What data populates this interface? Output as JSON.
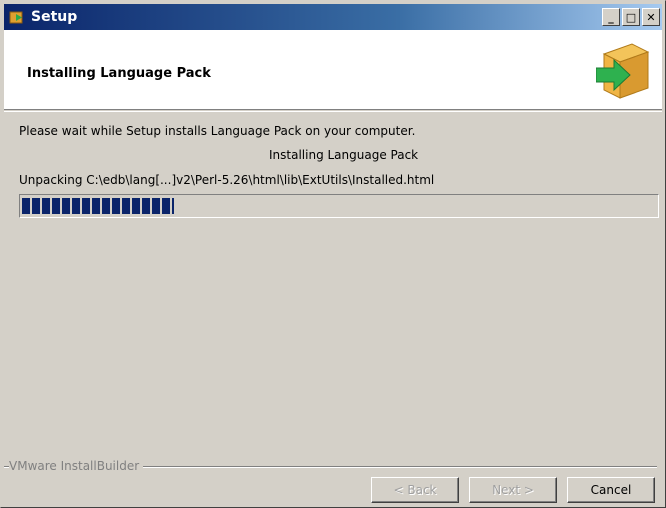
{
  "window": {
    "title": "Setup",
    "controls": {
      "minimize": "_",
      "maximize": "□",
      "close": "✕"
    }
  },
  "header": {
    "title": "Installing Language Pack",
    "icon": "install-box-arrow-icon"
  },
  "body": {
    "message": "Please wait while Setup installs Language Pack on your computer.",
    "status": "Installing Language Pack",
    "detail": "Unpacking C:\\edb\\lang[...]v2\\Perl-5.26\\html\\lib\\ExtUtils\\Installed.html",
    "progress_percent": 24
  },
  "footer": {
    "brand": "VMware InstallBuilder",
    "buttons": {
      "back": "< Back",
      "next": "Next >",
      "cancel": "Cancel"
    }
  },
  "colors": {
    "titlebar_start": "#0a246a",
    "titlebar_end": "#a6caf0",
    "progress_fill": "#0a246a",
    "face": "#d4d0c8"
  }
}
